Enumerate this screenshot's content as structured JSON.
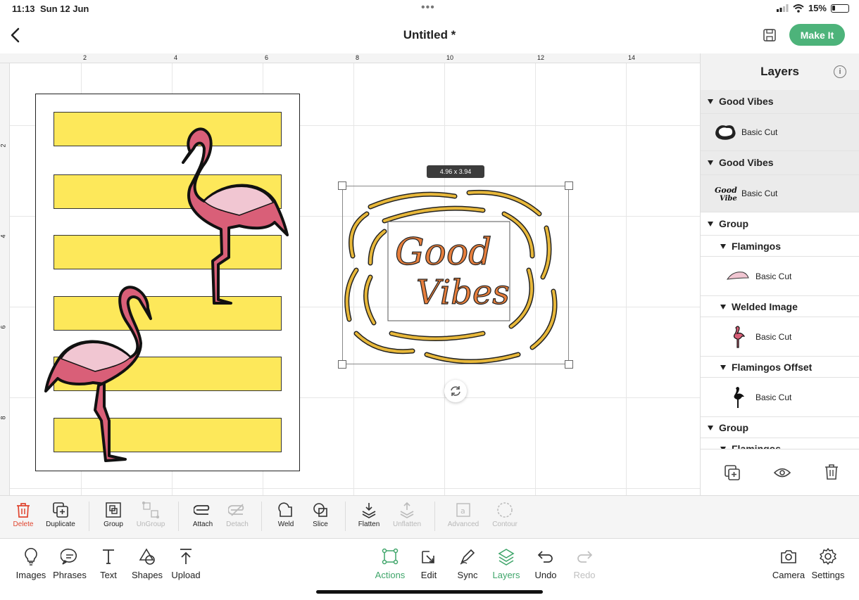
{
  "status_bar": {
    "time": "11:13",
    "date": "Sun 12 Jun",
    "battery": "15%"
  },
  "header": {
    "title": "Untitled *",
    "make_it_label": "Make It"
  },
  "canvas": {
    "ruler_top": [
      "2",
      "4",
      "6",
      "8",
      "10",
      "12",
      "14"
    ],
    "ruler_left": [
      "2",
      "4",
      "6",
      "8"
    ],
    "selection_size": "4.96 x 3.94",
    "good_vibes_text": [
      "Good",
      "Vibes"
    ]
  },
  "layers_panel": {
    "title": "Layers",
    "items": [
      {
        "name": "Good Vibes",
        "cut": "Basic Cut",
        "icon": "offset-blob-icon"
      },
      {
        "name": "Good Vibes",
        "cut": "Basic Cut",
        "icon": "good-vibes-thumb-icon"
      },
      {
        "group": "Group"
      },
      {
        "name": "Flamingos",
        "cut": "Basic Cut",
        "icon": "pink-wing-icon"
      },
      {
        "name": "Welded Image",
        "cut": "Basic Cut",
        "icon": "flamingo-color-icon"
      },
      {
        "name": "Flamingos Offset",
        "cut": "Basic Cut",
        "icon": "flamingo-black-icon"
      },
      {
        "group": "Group"
      },
      {
        "name": "Flamingos"
      }
    ]
  },
  "actions": {
    "delete": "Delete",
    "duplicate": "Duplicate",
    "group": "Group",
    "ungroup": "UnGroup",
    "attach": "Attach",
    "detach": "Detach",
    "weld": "Weld",
    "slice": "Slice",
    "flatten": "Flatten",
    "unflatten": "Unflatten",
    "advanced": "Advanced",
    "contour": "Contour"
  },
  "bottom_nav": {
    "images": "Images",
    "phrases": "Phrases",
    "text": "Text",
    "shapes": "Shapes",
    "upload": "Upload",
    "actions": "Actions",
    "edit": "Edit",
    "sync": "Sync",
    "layers": "Layers",
    "undo": "Undo",
    "redo": "Redo",
    "camera": "Camera",
    "settings": "Settings"
  },
  "colors": {
    "accent_green": "#4db37a",
    "stripe_yellow": "#fde85a",
    "flamingo_pink": "#d95f78",
    "wing_pink": "#f1c6d2",
    "swirl_gold": "#e8b83a",
    "text_orange": "#e67e3c",
    "delete_red": "#e0452f"
  }
}
